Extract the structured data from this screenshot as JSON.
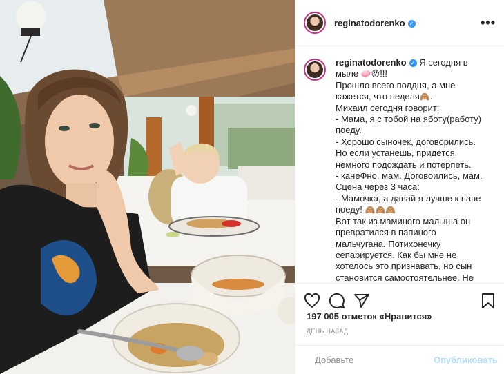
{
  "account": {
    "username": "reginatodorenko"
  },
  "header": {
    "more_icon": "more-options-icon"
  },
  "caption": {
    "username": "reginatodorenko",
    "lines": [
      "Я сегодня в мыле",
      "!!!",
      "Прошло всего полдня, а мне кажется, что неделя",
      "Михаил сегодня говорит:",
      "- Мама, я с тобой на яботу(работу) поеду.",
      "- Хорошо сыночек, договорились. Но если устанешь, придётся немного подождать и потерпеть.",
      "- канеФно, мам. Договоились, мам.",
      "Сцена через 3 часа:",
      "- Мамочка, а давай я лучше к папе поеду!",
      "Вот так из маминого малыша он превратился в папиного мальчугана. Потихонечку сепарируется. Как бы мне не хотелось это признавать, но сын становится самостоятельнее. Не"
    ],
    "emoji": {
      "after_soap": "🧼😡",
      "after_week": "🙈",
      "after_papa": "🙈🙈🙈"
    }
  },
  "actions": {
    "like_icon": "heart-icon",
    "comment_icon": "comment-icon",
    "share_icon": "share-icon",
    "save_icon": "bookmark-icon"
  },
  "likes": {
    "count": "197 005",
    "text": "отметок «Нравится»"
  },
  "timestamp": "ДЕНЬ НАЗАД",
  "comment": {
    "placeholder": "Добавьте",
    "publish_label": "Опубликовать"
  },
  "colors": {
    "accent": "#3897f0",
    "publish_disabled": "#b2dffc",
    "ring": "#c13584"
  }
}
